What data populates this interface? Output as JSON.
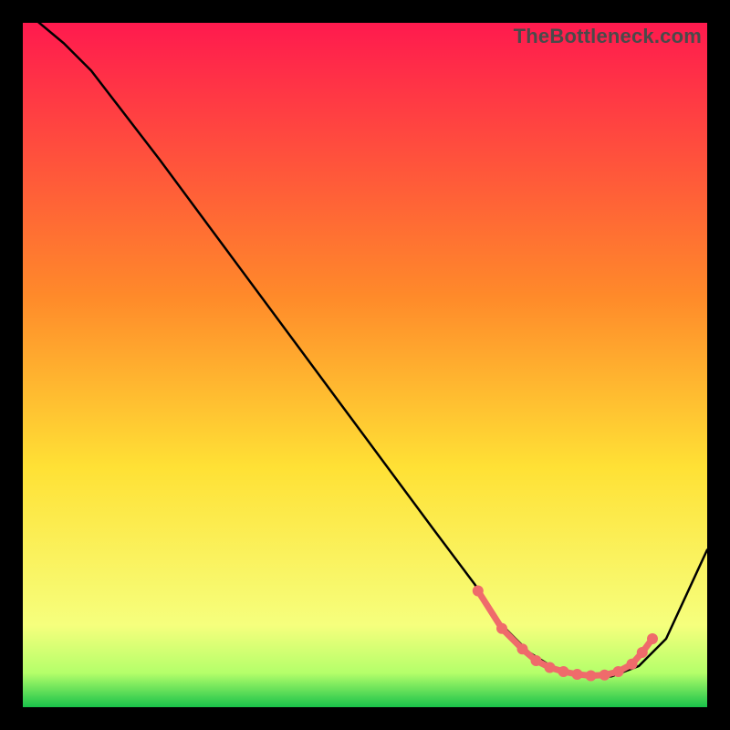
{
  "watermark": "TheBottleneck.com",
  "colors": {
    "bg": "#000000",
    "curve": "#000000",
    "marker_fill": "#ef6b6b",
    "marker_stroke": "#ef6b6b",
    "grad_top": "#ff1a4e",
    "grad_mid1": "#ff8a2a",
    "grad_mid2": "#ffe135",
    "grad_low": "#f6ff7d",
    "grad_green_top": "#b4ff6a",
    "grad_green_bot": "#19c24a"
  },
  "chart_data": {
    "type": "line",
    "title": "",
    "xlabel": "",
    "ylabel": "",
    "xlim": [
      0,
      100
    ],
    "ylim": [
      0,
      100
    ],
    "curve": {
      "x": [
        0,
        6,
        10,
        20,
        30,
        40,
        50,
        60,
        66,
        70,
        74,
        78,
        82,
        86,
        90,
        94,
        100
      ],
      "y": [
        102,
        97,
        93,
        80,
        66.5,
        53,
        39.5,
        26,
        18,
        12,
        8,
        5.5,
        4.5,
        4.5,
        6,
        10,
        23
      ]
    },
    "series": [
      {
        "name": "salmon-dots",
        "x": [
          66.5,
          70,
          73,
          75,
          77,
          79,
          81,
          83,
          85,
          87,
          89,
          90.5,
          92
        ],
        "y": [
          17,
          11.5,
          8.5,
          6.8,
          5.8,
          5.2,
          4.8,
          4.6,
          4.7,
          5.2,
          6.3,
          8,
          10
        ]
      }
    ]
  }
}
